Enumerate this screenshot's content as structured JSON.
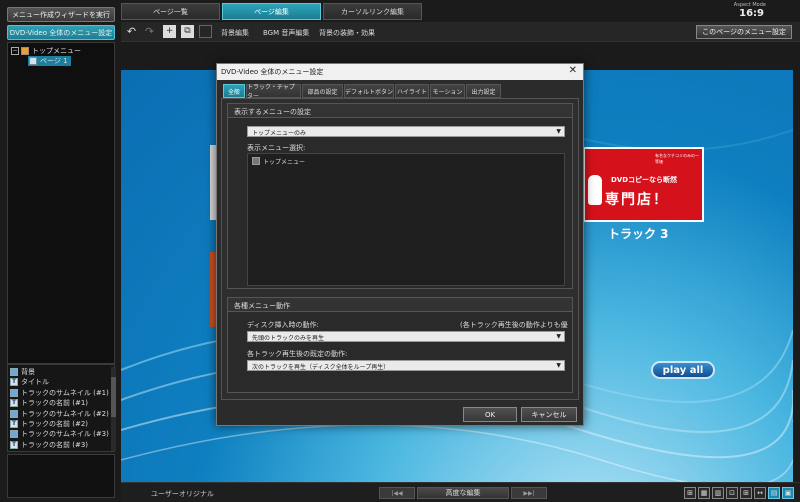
{
  "left_panel": {
    "wizard_button": "メニュー作成ウィザードを実行",
    "global_menu_button": "DVD-Video 全体のメニュー設定",
    "tree": {
      "root_toggle": "−",
      "root_label": "トップメニュー",
      "child_label": "ページ 1"
    },
    "layers": [
      {
        "icon": "image",
        "label": "背景"
      },
      {
        "icon": "T",
        "label": "タイトル"
      },
      {
        "icon": "image",
        "label": "トラックのサムネイル (#1)"
      },
      {
        "icon": "T",
        "label": "トラックの名前 (#1)"
      },
      {
        "icon": "image",
        "label": "トラックのサムネイル (#2)"
      },
      {
        "icon": "T",
        "label": "トラックの名前 (#2)"
      },
      {
        "icon": "image",
        "label": "トラックのサムネイル (#3)"
      },
      {
        "icon": "T",
        "label": "トラックの名前 (#3)"
      }
    ]
  },
  "tabs": [
    {
      "label": "ページ一覧",
      "active": false
    },
    {
      "label": "ページ編集",
      "active": true
    },
    {
      "label": "カーソルリンク編集",
      "active": false
    }
  ],
  "aspect": {
    "label": "Aspect Mode",
    "value": "16:9"
  },
  "toolbar": {
    "icons": [
      "undo-icon",
      "redo-icon",
      "add-page-icon",
      "duplicate-page-icon",
      "delete-page-icon"
    ],
    "links": [
      "背景編集",
      "BGM 音声編集",
      "背景の装飾・効果"
    ],
    "page_menu_button": "このページのメニュー設定"
  },
  "canvas": {
    "track3": {
      "small_text": "有名なクチコミのみの一等価",
      "line1": "DVDコピーなら断然",
      "line2": "専門店！",
      "label": "トラック 3"
    },
    "play_all": "play all"
  },
  "bottombar": {
    "user_label": "ユーザーオリジナル",
    "prev": "|◀◀",
    "advanced_edit": "高度な編集",
    "next": "▶▶|",
    "view_icons": [
      "⊞",
      "▦",
      "▥",
      "⊡",
      "⊞",
      "↔",
      "▤",
      "▣"
    ]
  },
  "dialog": {
    "title": "DVD-Video 全体のメニュー設定",
    "close": "✕",
    "tabs": [
      {
        "label": "全般",
        "active": true
      },
      {
        "label": "トラック・チャプター",
        "active": false
      },
      {
        "label": "部品の設定",
        "active": false
      },
      {
        "label": "デフォルトボタン",
        "active": false
      },
      {
        "label": "ハイライト",
        "active": false
      },
      {
        "label": "モーション",
        "active": false
      },
      {
        "label": "出力設定",
        "active": false
      }
    ],
    "group1": {
      "title": "表示するメニューの設定",
      "combo_value": "トップメニューのみ",
      "select_label": "表示メニュー選択:",
      "checkbox_label": "トップメニュー"
    },
    "group2": {
      "title": "各種メニュー動作",
      "disc_insert_label": "ディスク挿入時の動作:",
      "disc_insert_note": "(各トラック再生後の動作よりも優先)",
      "disc_insert_value": "先頭のトラックのみを再生",
      "after_track_label": "各トラック再生後の既定の動作:",
      "after_track_value": "次のトラックを再生（ディスク全体をループ再生）"
    },
    "ok": "OK",
    "cancel": "キャンセル"
  }
}
